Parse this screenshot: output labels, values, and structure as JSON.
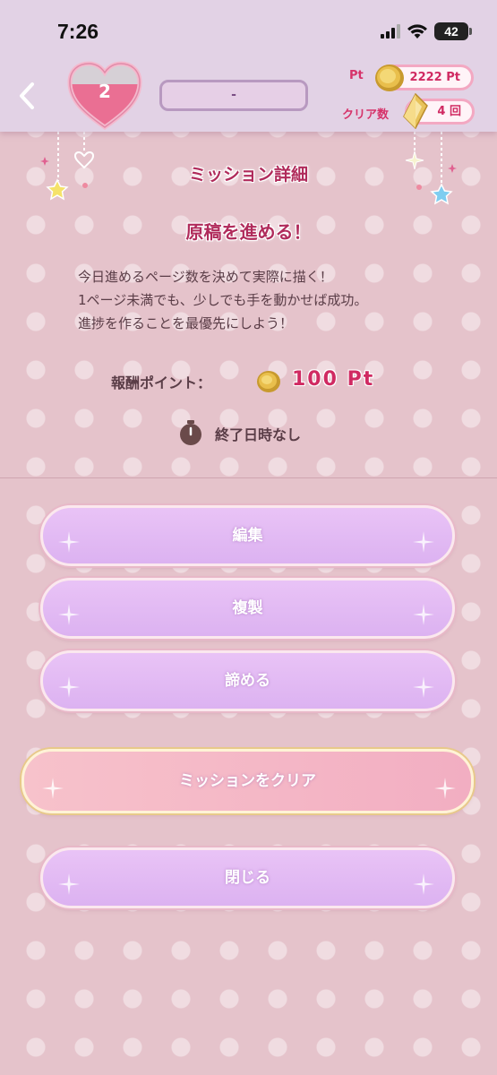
{
  "status_bar": {
    "time": "7:26",
    "battery": "42"
  },
  "header": {
    "hearts": "2",
    "name_value": "-",
    "pt_label": "Pt",
    "pt_value": "2222 Pt",
    "clear_label": "クリア数",
    "clear_value": "4 回"
  },
  "mission": {
    "heading": "ミッション詳細",
    "title": "原稿を進める！",
    "description": [
      "今日進めるページ数を決めて実際に描く！",
      "1ページ未満でも、少しでも手を動かせば成功。",
      "進捗を作ることを最優先にしよう！"
    ],
    "reward_label": "報酬ポイント：",
    "reward_value": "100 Pt",
    "deadline": "終了日時なし"
  },
  "buttons": {
    "edit": "編集",
    "duplicate": "複製",
    "give_up": "諦める",
    "clear": "ミッションをクリア",
    "close": "閉じる"
  },
  "colors": {
    "accent": "#d02a62",
    "button_purple": "#e2bcf4",
    "button_pink": "#f4b6c5",
    "background": "#e5c3cb"
  },
  "icons": [
    "back-chevron-icon",
    "heart-icon",
    "coin-icon",
    "crystal-icon",
    "timer-icon",
    "star-icon",
    "sparkle-icon"
  ]
}
